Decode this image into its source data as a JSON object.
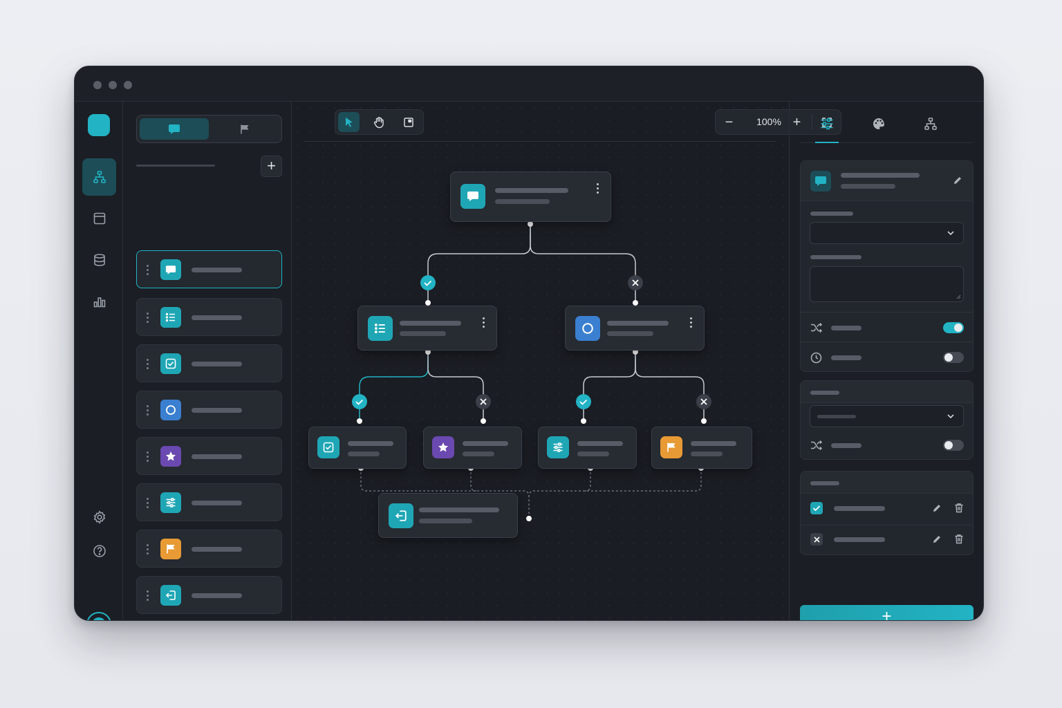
{
  "window": {
    "traffic_lights": [
      "close",
      "minimize",
      "maximize"
    ]
  },
  "rail": {
    "items": [
      {
        "icon": "flowchart-icon",
        "active": true
      },
      {
        "icon": "form-icon",
        "active": false
      },
      {
        "icon": "database-icon",
        "active": false
      },
      {
        "icon": "analytics-icon",
        "active": false
      }
    ],
    "bottom": [
      {
        "icon": "settings-icon"
      },
      {
        "icon": "help-icon"
      }
    ]
  },
  "palette": {
    "tabs": [
      {
        "icon": "chat-icon",
        "active": true
      },
      {
        "icon": "flag-icon",
        "active": false
      }
    ],
    "add_label": "+",
    "items": [
      {
        "icon": "chat-icon",
        "color": "#1fa6b5"
      },
      {
        "icon": "list-icon",
        "color": "#1fa6b5"
      },
      {
        "icon": "checkbox-icon",
        "color": "#1fa6b5"
      },
      {
        "icon": "circle-icon",
        "color": "#3a7fd0"
      },
      {
        "icon": "star-icon",
        "color": "#6a49b0"
      },
      {
        "icon": "sliders-icon",
        "color": "#1fa6b5"
      },
      {
        "icon": "flag-icon",
        "color": "#e89a35"
      },
      {
        "icon": "exit-icon",
        "color": "#1fa6b5"
      }
    ]
  },
  "canvas": {
    "tools": [
      "pointer-icon",
      "hand-icon",
      "frame-icon"
    ],
    "zoom": {
      "minus": "−",
      "value": "100%",
      "plus": "+"
    },
    "nodes": [
      {
        "id": "start",
        "icon": "chat-icon",
        "color": "#1fa6b5"
      },
      {
        "id": "branch-a",
        "icon": "list-icon",
        "color": "#1fa6b5"
      },
      {
        "id": "branch-b",
        "icon": "circle-icon",
        "color": "#3a7fd0"
      },
      {
        "id": "leaf-1",
        "icon": "checkbox-icon",
        "color": "#1fa6b5"
      },
      {
        "id": "leaf-2",
        "icon": "star-icon",
        "color": "#6a49b0"
      },
      {
        "id": "leaf-3",
        "icon": "sliders-icon",
        "color": "#1fa6b5"
      },
      {
        "id": "leaf-4",
        "icon": "flag-icon",
        "color": "#e89a35"
      },
      {
        "id": "end",
        "icon": "exit-icon",
        "color": "#1fa6b5"
      }
    ]
  },
  "panel": {
    "tabs": [
      "sliders-icon",
      "palette-icon",
      "hierarchy-icon"
    ],
    "active_tab": 0,
    "toggles": {
      "shuffle": true,
      "timer": false,
      "shuffle2": false
    },
    "add_label": "+"
  },
  "colors": {
    "accent": "#22b3c4",
    "background": "#1b1e24",
    "card": "#272b32"
  }
}
